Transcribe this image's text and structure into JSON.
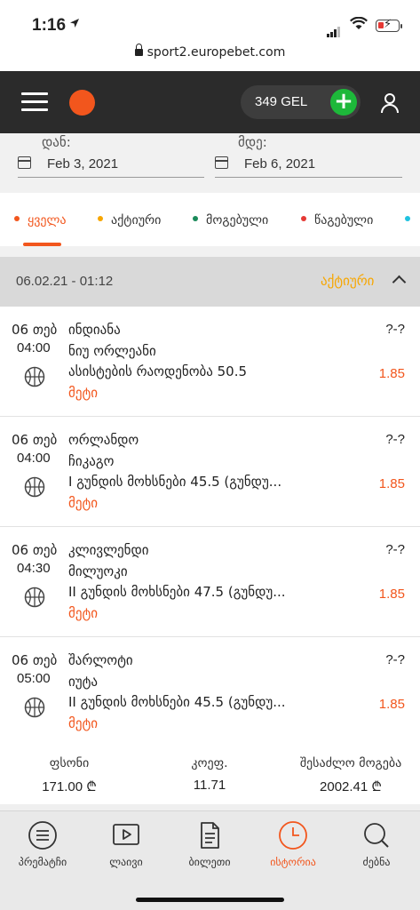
{
  "status_bar": {
    "time": "1:16"
  },
  "url": "sport2.europebet.com",
  "header": {
    "balance": "349 GEL"
  },
  "date_filter": {
    "from_label": "დან:",
    "from_value": "Feb 3, 2021",
    "to_label": "მდე:",
    "to_value": "Feb 6, 2021"
  },
  "tabs": [
    {
      "label": "ყველა",
      "color": "#f2561d",
      "active": true
    },
    {
      "label": "აქტიური",
      "color": "#f7a600"
    },
    {
      "label": "მოგებული",
      "color": "#1a8a5a"
    },
    {
      "label": "წაგებული",
      "color": "#e53935"
    },
    {
      "label": "",
      "color": "#1fc2e0"
    }
  ],
  "ticket": {
    "datetime": "06.02.21 - 01:12",
    "status": "აქტიური",
    "bets": [
      {
        "date": "06 თებ",
        "time": "04:00",
        "team1": "ინდიანა",
        "team2": "ნიუ ორლეანი",
        "market": "ასისტების რაოდენობა 50.5",
        "more": "მეტი",
        "score": "?-?",
        "odd": "1.85",
        "sport_icon": "basketball-icon"
      },
      {
        "date": "06 თებ",
        "time": "04:00",
        "team1": "ორლანდო",
        "team2": "ჩიკაგო",
        "market": "I გუნდის მოხსნები 45.5 (გუნდუ...",
        "more": "მეტი",
        "score": "?-?",
        "odd": "1.85",
        "sport_icon": "basketball-icon"
      },
      {
        "date": "06 თებ",
        "time": "04:30",
        "team1": "კლივლენდი",
        "team2": "მილუოკი",
        "market": "II გუნდის მოხსნები 47.5 (გუნდუ...",
        "more": "მეტი",
        "score": "?-?",
        "odd": "1.85",
        "sport_icon": "basketball-icon"
      },
      {
        "date": "06 თებ",
        "time": "05:00",
        "team1": "შარლოტი",
        "team2": "იუტა",
        "market": "II გუნდის მოხსნები 45.5 (გუნდუ...",
        "more": "მეტი",
        "score": "?-?",
        "odd": "1.85",
        "sport_icon": "basketball-icon"
      }
    ],
    "summary": {
      "stake_label": "ფსონი",
      "stake_value": "171.00 ₾",
      "coef_label": "კოეფ.",
      "coef_value": "11.71",
      "win_label": "შესაძლო მოგება",
      "win_value": "2002.41 ₾"
    }
  },
  "bottom_nav": [
    {
      "label": "პრემატჩი",
      "icon": "list-icon"
    },
    {
      "label": "ლაივი",
      "icon": "play-icon"
    },
    {
      "label": "ბილეთი",
      "icon": "ticket-icon"
    },
    {
      "label": "ისტორია",
      "icon": "history-icon",
      "active": true
    },
    {
      "label": "ძებნა",
      "icon": "search-icon"
    }
  ],
  "colors": {
    "accent": "#f2561d",
    "active_status": "#f7a600",
    "topbar": "#2b2b2b",
    "plus_button": "#1db83a"
  }
}
